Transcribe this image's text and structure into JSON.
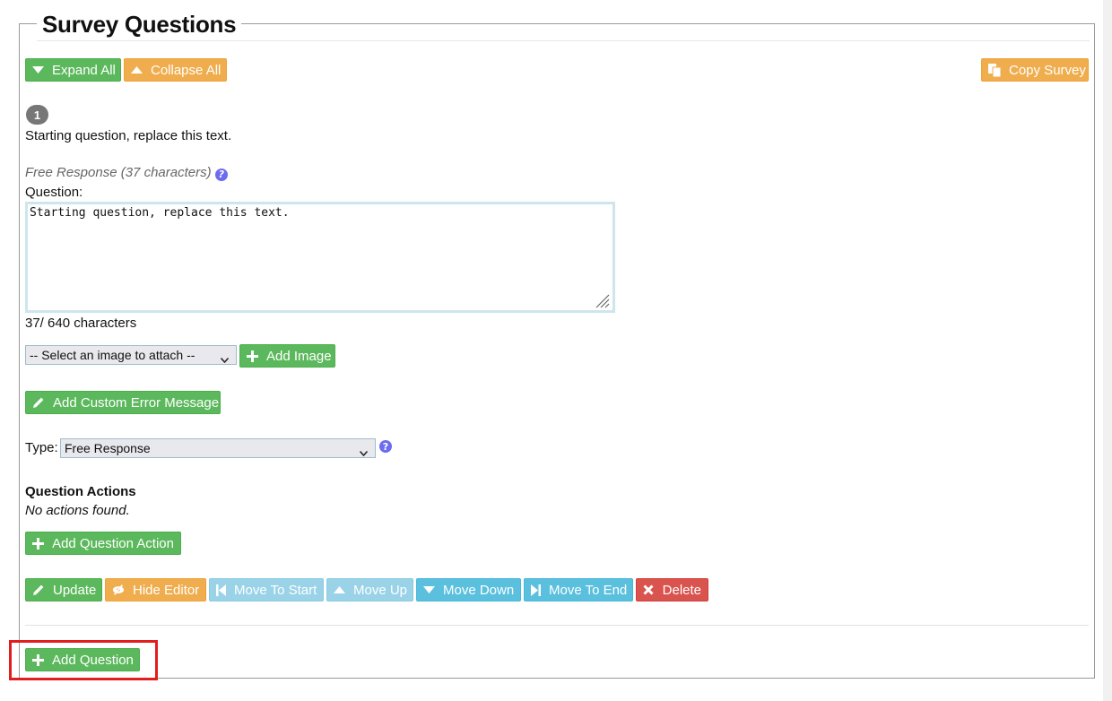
{
  "section": {
    "title": "Survey Questions"
  },
  "toolbar": {
    "expand_all": "Expand All",
    "collapse_all": "Collapse All",
    "copy_survey": "Copy Survey"
  },
  "question": {
    "number": "1",
    "summary_text": "Starting question, replace this text.",
    "type_info": "Free Response (37 characters)",
    "question_label": "Question:",
    "question_value": "Starting question, replace this text.",
    "char_count": "37/ 640 characters",
    "image_select_value": "-- Select an image to attach --",
    "add_image": "Add Image",
    "add_custom_error": "Add Custom Error Message",
    "type_label": "Type:",
    "type_value": "Free Response",
    "actions_heading": "Question Actions",
    "no_actions": "No actions found.",
    "add_action": "Add Question Action"
  },
  "action_bar": {
    "update": "Update",
    "hide_editor": "Hide Editor",
    "move_to_start": "Move To Start",
    "move_up": "Move Up",
    "move_down": "Move Down",
    "move_to_end": "Move To End",
    "delete": "Delete"
  },
  "footer": {
    "add_question": "Add Question"
  },
  "colors": {
    "success": "#5cb85c",
    "warning": "#f0ad4e",
    "info": "#5bc0de",
    "info_disabled": "#9ad3e8",
    "danger": "#d9534f",
    "highlight": "#e31d1d"
  }
}
